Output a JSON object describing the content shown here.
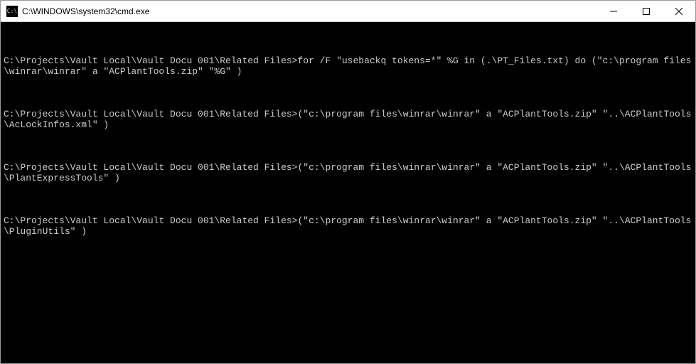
{
  "titlebar": {
    "title": "C:\\WINDOWS\\system32\\cmd.exe",
    "icon_label": "cmd-icon"
  },
  "console": {
    "lines": [
      "C:\\Projects\\Vault Local\\Vault Docu 001\\Related Files>for /F \"usebackq tokens=*\" %G in (.\\PT_Files.txt) do (\"c:\\program files\\winrar\\winrar\" a \"ACPlantTools.zip\" \"%G\" )",
      "C:\\Projects\\Vault Local\\Vault Docu 001\\Related Files>(\"c:\\program files\\winrar\\winrar\" a \"ACPlantTools.zip\" \"..\\ACPlantTools\\AcLockInfos.xml\" )",
      "C:\\Projects\\Vault Local\\Vault Docu 001\\Related Files>(\"c:\\program files\\winrar\\winrar\" a \"ACPlantTools.zip\" \"..\\ACPlantTools\\PlantExpressTools\" )",
      "C:\\Projects\\Vault Local\\Vault Docu 001\\Related Files>(\"c:\\program files\\winrar\\winrar\" a \"ACPlantTools.zip\" \"..\\ACPlantTools\\PluginUtils\" )"
    ]
  }
}
